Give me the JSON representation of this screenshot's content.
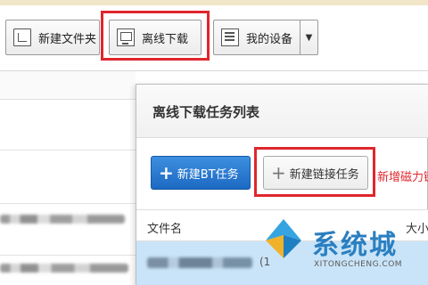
{
  "toolbar": {
    "new_folder": "新建文件夹",
    "offline_download": "离线下载",
    "my_devices": "我的设备",
    "dropdown_icon": "chevron-down-icon"
  },
  "dialog": {
    "title": "离线下载任务列表",
    "new_bt_task": "新建BT任务",
    "new_link_task": "新建链接任务",
    "new_magnet_partial": "新增磁力链",
    "columns": {
      "filename": "文件名",
      "size": "大小"
    },
    "rows": [
      {
        "name": "",
        "count": "(1"
      }
    ]
  },
  "watermark": {
    "brand": "系统城",
    "domain": "XITONGCHENG.COM"
  },
  "colors": {
    "highlight": "#e0262d",
    "primary_button": "#1c69c2",
    "selected_row": "#c9e4f8",
    "brand": "#2a7fc0"
  }
}
